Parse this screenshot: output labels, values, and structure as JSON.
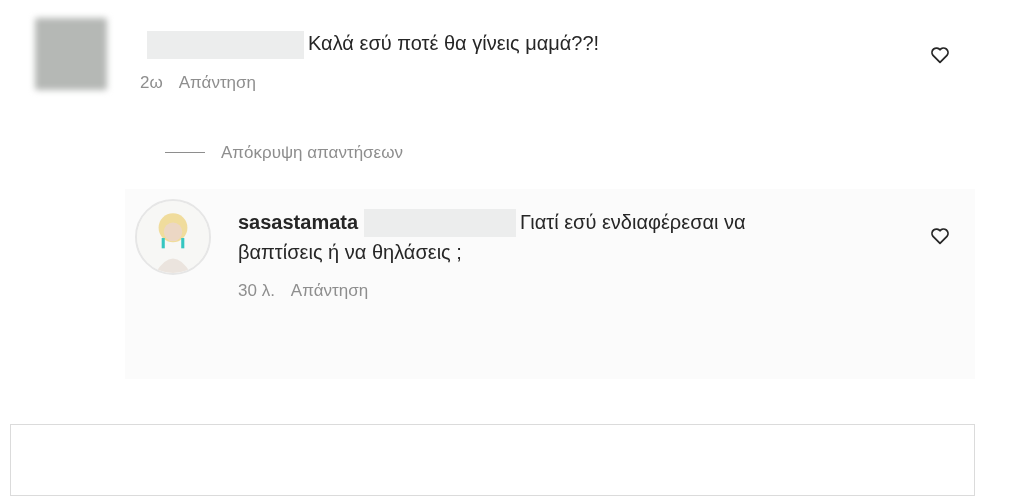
{
  "comments": [
    {
      "name_hidden": true,
      "text": "Καλά εσύ ποτέ θα γίνεις μαμά??!",
      "time": "2ω",
      "reply_label": "Απάντηση",
      "liked": false,
      "avatar": {
        "kind": "blurred"
      },
      "hide_replies": "Απόκρυψη απαντήσεων",
      "replies": [
        {
          "username": "sasastamata",
          "name_hidden": true,
          "text": "Γιατί εσύ ενδιαφέρεσαι να βαπτίσεις ή να θηλάσεις ;",
          "time": "30 λ.",
          "reply_label": "Απάντηση",
          "liked": false,
          "avatar": {
            "kind": "figure"
          }
        }
      ]
    }
  ],
  "composer": {
    "kind": "empty"
  }
}
